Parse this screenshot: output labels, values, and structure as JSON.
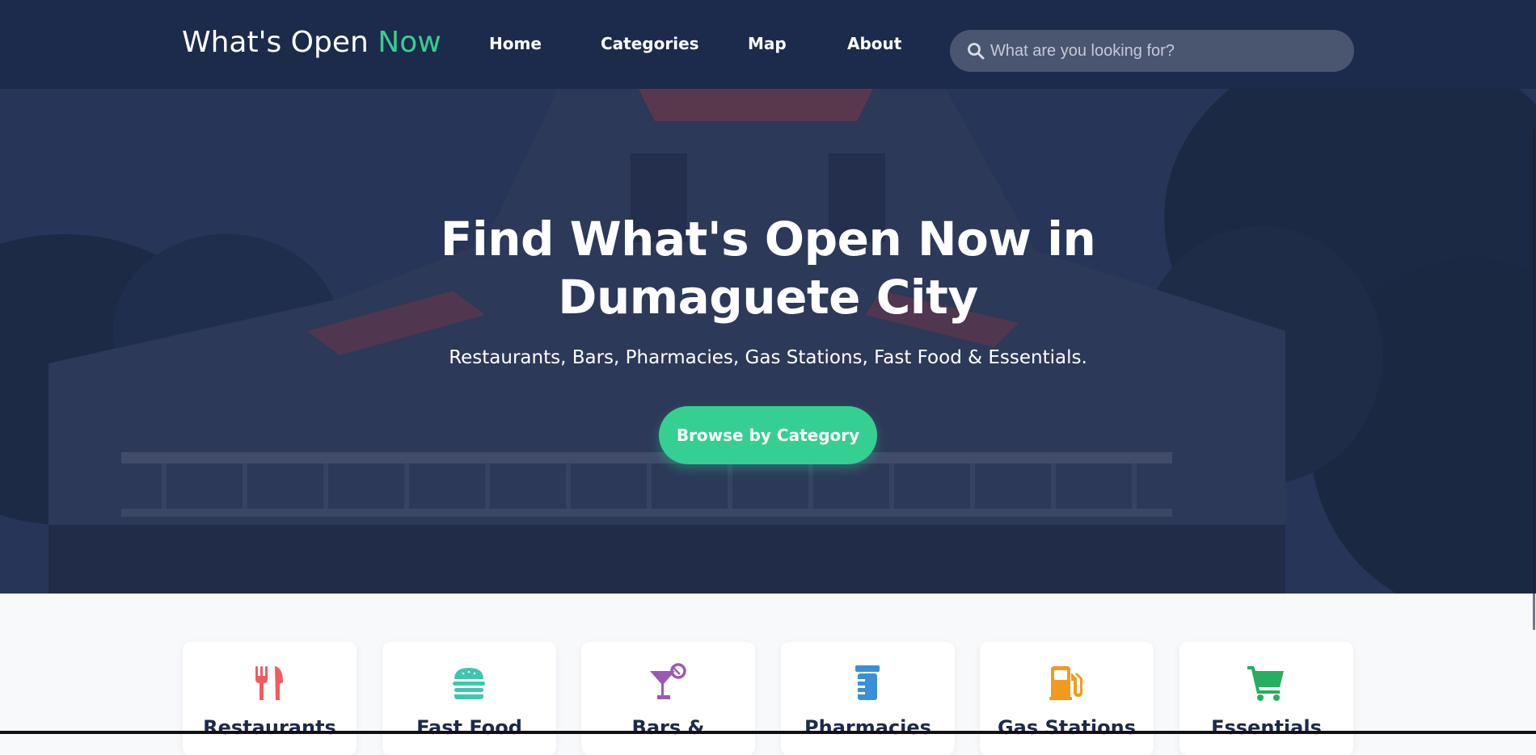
{
  "header": {
    "logo_main": "What's Open",
    "logo_accent": "Now",
    "nav": [
      "Home",
      "Categories",
      "Map",
      "About"
    ],
    "search_placeholder": "What are you looking for?"
  },
  "hero": {
    "title_line1": "Find What's Open Now in",
    "title_line2": "Dumaguete City",
    "subtitle": "Restaurants, Bars, Pharmacies, Gas Stations, Fast Food & Essentials.",
    "cta_label": "Browse by Category"
  },
  "categories": [
    {
      "label": "Restaurants",
      "icon": "utensils-icon",
      "color": "#f15b60"
    },
    {
      "label": "Fast Food",
      "icon": "burger-icon",
      "color": "#3fc6b0"
    },
    {
      "label": "Bars &",
      "icon": "cocktail-icon",
      "color": "#9b59b6"
    },
    {
      "label": "Pharmacies",
      "icon": "prescription-bottle-icon",
      "color": "#3a8fd9"
    },
    {
      "label": "Gas Stations",
      "icon": "gas-pump-icon",
      "color": "#f29a1f"
    },
    {
      "label": "Essentials",
      "icon": "shopping-cart-icon",
      "color": "#27ae60"
    }
  ],
  "colors": {
    "header_bg": "#1c2a4b",
    "accent": "#35cf91"
  }
}
